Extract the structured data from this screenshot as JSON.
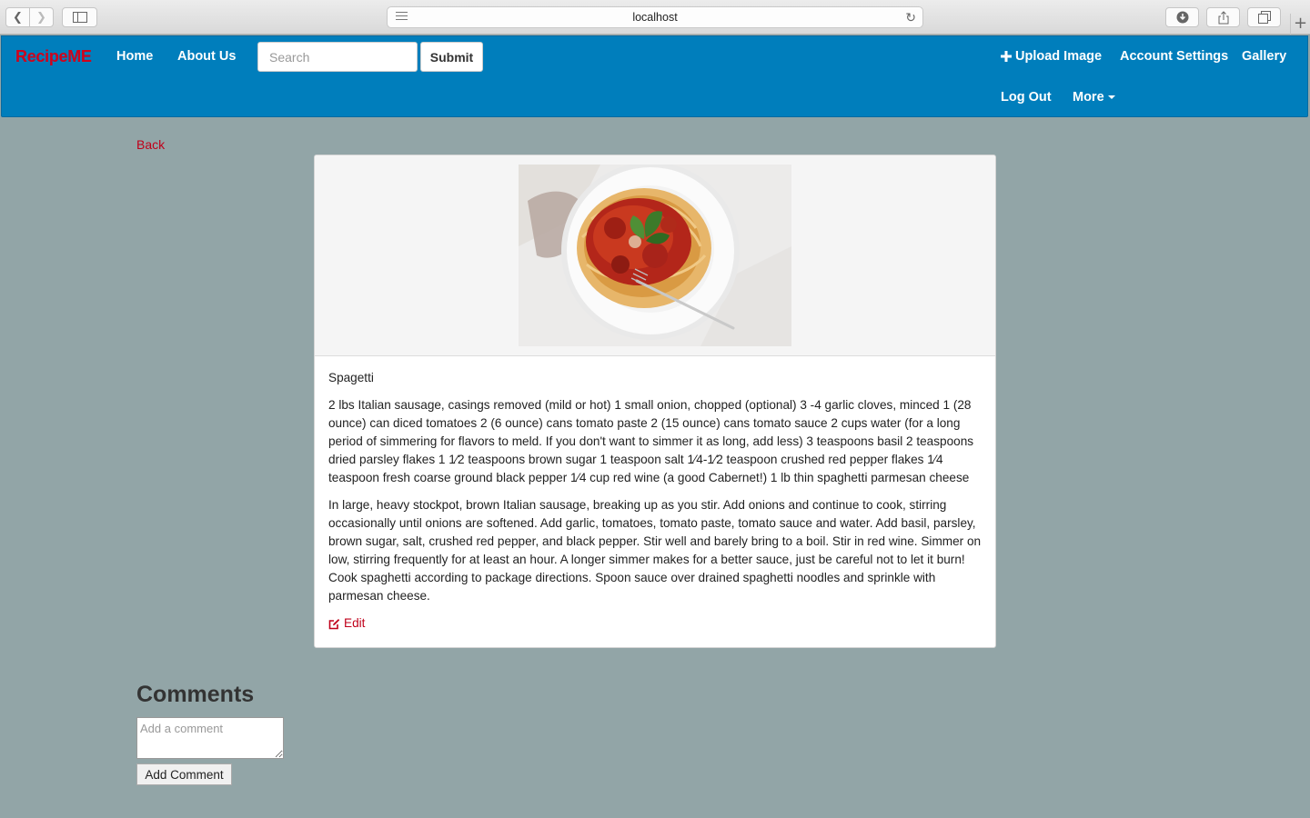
{
  "browser": {
    "url": "localhost"
  },
  "navbar": {
    "brand": "RecipeME",
    "links": [
      "Home",
      "About Us"
    ],
    "search_placeholder": "Search",
    "submit_label": "Submit",
    "upload_label": "Upload Image",
    "account_label": "Account Settings",
    "gallery_label": "Gallery",
    "logout_label": "Log Out",
    "more_label": "More"
  },
  "page": {
    "back_label": "Back",
    "recipe": {
      "title": "Spagetti",
      "ingredients": "2 lbs Italian sausage, casings removed (mild or hot) 1 small onion, chopped (optional) 3 -4 garlic cloves, minced 1 (28 ounce) can diced tomatoes 2 (6 ounce) cans tomato paste 2 (15 ounce) cans tomato sauce 2 cups water (for a long period of simmering for flavors to meld. If you don't want to simmer it as long, add less) 3 teaspoons basil 2 teaspoons dried parsley flakes 1 1⁄2 teaspoons brown sugar 1 teaspoon salt 1⁄4-1⁄2 teaspoon crushed red pepper flakes 1⁄4 teaspoon fresh coarse ground black pepper 1⁄4 cup red wine (a good Cabernet!) 1 lb thin spaghetti parmesan cheese",
      "directions": "In large, heavy stockpot, brown Italian sausage, breaking up as you stir. Add onions and continue to cook, stirring occasionally until onions are softened. Add garlic, tomatoes, tomato paste, tomato sauce and water. Add basil, parsley, brown sugar, salt, crushed red pepper, and black pepper. Stir well and barely bring to a boil. Stir in red wine. Simmer on low, stirring frequently for at least an hour. A longer simmer makes for a better sauce, just be careful not to let it burn! Cook spaghetti according to package directions. Spoon sauce over drained spaghetti noodles and sprinkle with parmesan cheese.",
      "edit_label": "Edit"
    },
    "comments": {
      "title": "Comments",
      "placeholder": "Add a comment",
      "add_label": "Add Comment"
    }
  },
  "colors": {
    "navbar": "#007ebc",
    "brand": "#d0021b",
    "link_red": "#c0001a",
    "page_bg": "#92a5a7"
  }
}
